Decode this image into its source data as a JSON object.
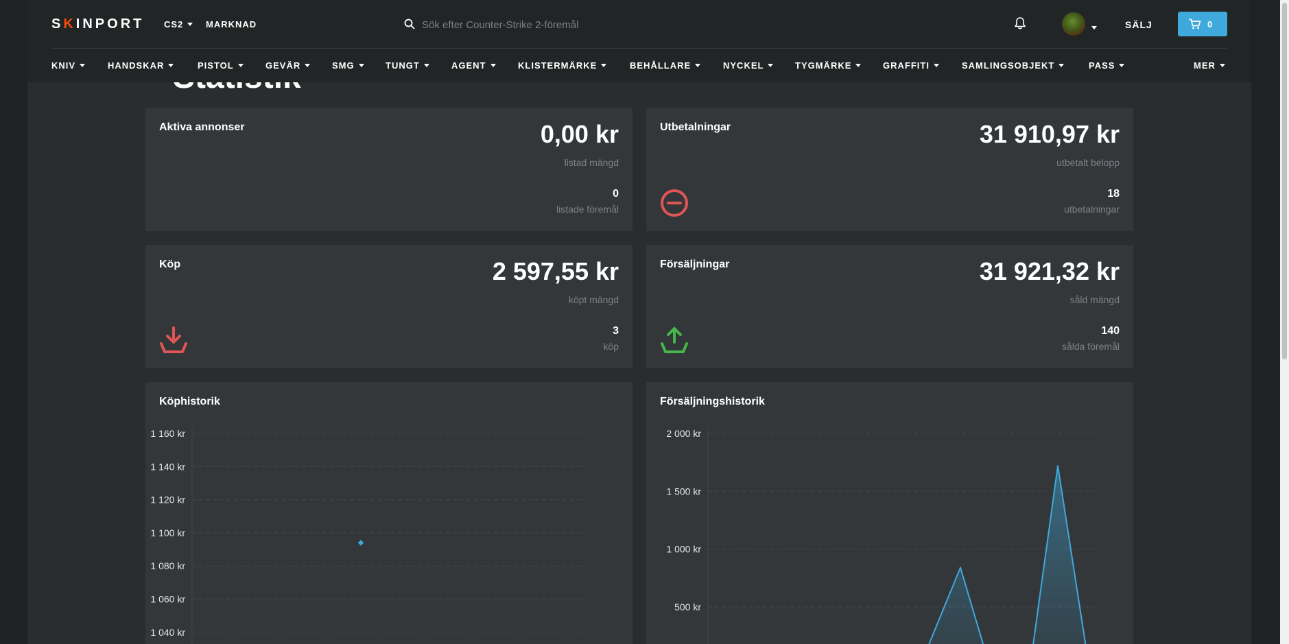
{
  "header": {
    "logo": {
      "pre": "S",
      "dot": "K",
      "post": "INPORT"
    },
    "game": "CS2",
    "market": "MARKNAD",
    "search_placeholder": "Sök efter Counter-Strike 2-föremål",
    "sell": "SÄLJ",
    "cart_count": "0",
    "accent_color": "#3fa9dc"
  },
  "categories": [
    {
      "label": "KNIV"
    },
    {
      "label": "HANDSKAR"
    },
    {
      "label": "PISTOL"
    },
    {
      "label": "GEVÄR"
    },
    {
      "label": "SMG"
    },
    {
      "label": "TUNGT"
    },
    {
      "label": "AGENT"
    },
    {
      "label": "KLISTERMÄRKE"
    },
    {
      "label": "BEHÅLLARE"
    },
    {
      "label": "NYCKEL"
    },
    {
      "label": "TYGMÄRKE"
    },
    {
      "label": "GRAFFITI"
    },
    {
      "label": "SAMLINGSOBJEKT"
    },
    {
      "label": "PASS"
    },
    {
      "label": "MER"
    }
  ],
  "page": {
    "title": "Statistik"
  },
  "cards": {
    "active": {
      "title": "Aktiva annonser",
      "value": "0,00 kr",
      "value_label": "listad mängd",
      "count": "0",
      "count_label": "listade föremål"
    },
    "payouts": {
      "title": "Utbetalningar",
      "value": "31 910,97 kr",
      "value_label": "utbetalt belopp",
      "count": "18",
      "count_label": "utbetalningar",
      "icon": "minus-circle-icon",
      "icon_color": "#e05555"
    },
    "purchases": {
      "title": "Köp",
      "value": "2 597,55 kr",
      "value_label": "köpt mängd",
      "count": "3",
      "count_label": "köp",
      "icon": "download-icon",
      "icon_color": "#e05555"
    },
    "sales": {
      "title": "Försäljningar",
      "value": "31 921,32 kr",
      "value_label": "såld mängd",
      "count": "140",
      "count_label": "sålda föremål",
      "icon": "upload-icon",
      "icon_color": "#45b649"
    }
  },
  "chart_data": [
    {
      "type": "scatter",
      "title": "Köphistorik",
      "yticks": [
        "1 160 kr",
        "1 140 kr",
        "1 120 kr",
        "1 100 kr",
        "1 080 kr",
        "1 060 kr",
        "1 040 kr"
      ],
      "ylim": [
        1040,
        1160
      ],
      "points": [
        {
          "x": 0.5,
          "y": 1094
        }
      ],
      "color": "#3fa9dc",
      "grid": true
    },
    {
      "type": "area",
      "title": "Försäljningshistorik",
      "yticks": [
        "2 000 kr",
        "1 500 kr",
        "1 000 kr",
        "500 kr"
      ],
      "ylim": [
        500,
        2000
      ],
      "values": [
        0,
        840,
        0,
        1720,
        0
      ],
      "color": "#3fa9dc",
      "grid": true
    }
  ]
}
